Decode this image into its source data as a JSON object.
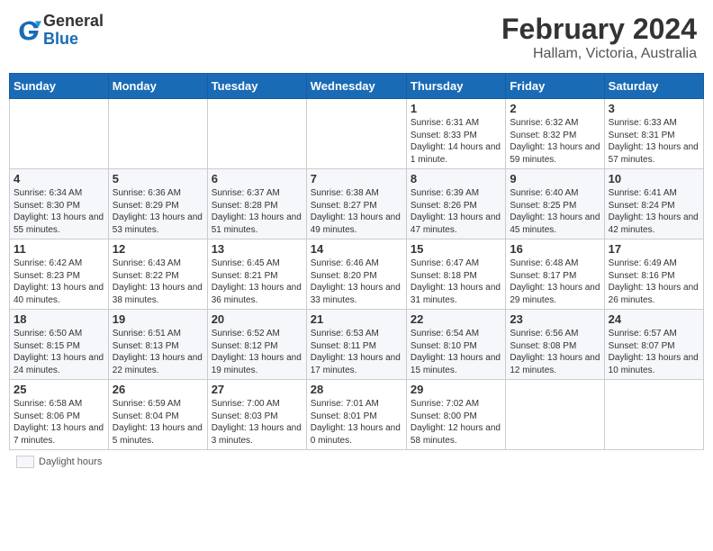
{
  "header": {
    "logo_general": "General",
    "logo_blue": "Blue",
    "month": "February 2024",
    "location": "Hallam, Victoria, Australia"
  },
  "legend": {
    "label": "Daylight hours"
  },
  "days_of_week": [
    "Sunday",
    "Monday",
    "Tuesday",
    "Wednesday",
    "Thursday",
    "Friday",
    "Saturday"
  ],
  "weeks": [
    [
      {
        "day": "",
        "info": ""
      },
      {
        "day": "",
        "info": ""
      },
      {
        "day": "",
        "info": ""
      },
      {
        "day": "",
        "info": ""
      },
      {
        "day": "1",
        "info": "Sunrise: 6:31 AM\nSunset: 8:33 PM\nDaylight: 14 hours and 1 minute."
      },
      {
        "day": "2",
        "info": "Sunrise: 6:32 AM\nSunset: 8:32 PM\nDaylight: 13 hours and 59 minutes."
      },
      {
        "day": "3",
        "info": "Sunrise: 6:33 AM\nSunset: 8:31 PM\nDaylight: 13 hours and 57 minutes."
      }
    ],
    [
      {
        "day": "4",
        "info": "Sunrise: 6:34 AM\nSunset: 8:30 PM\nDaylight: 13 hours and 55 minutes."
      },
      {
        "day": "5",
        "info": "Sunrise: 6:36 AM\nSunset: 8:29 PM\nDaylight: 13 hours and 53 minutes."
      },
      {
        "day": "6",
        "info": "Sunrise: 6:37 AM\nSunset: 8:28 PM\nDaylight: 13 hours and 51 minutes."
      },
      {
        "day": "7",
        "info": "Sunrise: 6:38 AM\nSunset: 8:27 PM\nDaylight: 13 hours and 49 minutes."
      },
      {
        "day": "8",
        "info": "Sunrise: 6:39 AM\nSunset: 8:26 PM\nDaylight: 13 hours and 47 minutes."
      },
      {
        "day": "9",
        "info": "Sunrise: 6:40 AM\nSunset: 8:25 PM\nDaylight: 13 hours and 45 minutes."
      },
      {
        "day": "10",
        "info": "Sunrise: 6:41 AM\nSunset: 8:24 PM\nDaylight: 13 hours and 42 minutes."
      }
    ],
    [
      {
        "day": "11",
        "info": "Sunrise: 6:42 AM\nSunset: 8:23 PM\nDaylight: 13 hours and 40 minutes."
      },
      {
        "day": "12",
        "info": "Sunrise: 6:43 AM\nSunset: 8:22 PM\nDaylight: 13 hours and 38 minutes."
      },
      {
        "day": "13",
        "info": "Sunrise: 6:45 AM\nSunset: 8:21 PM\nDaylight: 13 hours and 36 minutes."
      },
      {
        "day": "14",
        "info": "Sunrise: 6:46 AM\nSunset: 8:20 PM\nDaylight: 13 hours and 33 minutes."
      },
      {
        "day": "15",
        "info": "Sunrise: 6:47 AM\nSunset: 8:18 PM\nDaylight: 13 hours and 31 minutes."
      },
      {
        "day": "16",
        "info": "Sunrise: 6:48 AM\nSunset: 8:17 PM\nDaylight: 13 hours and 29 minutes."
      },
      {
        "day": "17",
        "info": "Sunrise: 6:49 AM\nSunset: 8:16 PM\nDaylight: 13 hours and 26 minutes."
      }
    ],
    [
      {
        "day": "18",
        "info": "Sunrise: 6:50 AM\nSunset: 8:15 PM\nDaylight: 13 hours and 24 minutes."
      },
      {
        "day": "19",
        "info": "Sunrise: 6:51 AM\nSunset: 8:13 PM\nDaylight: 13 hours and 22 minutes."
      },
      {
        "day": "20",
        "info": "Sunrise: 6:52 AM\nSunset: 8:12 PM\nDaylight: 13 hours and 19 minutes."
      },
      {
        "day": "21",
        "info": "Sunrise: 6:53 AM\nSunset: 8:11 PM\nDaylight: 13 hours and 17 minutes."
      },
      {
        "day": "22",
        "info": "Sunrise: 6:54 AM\nSunset: 8:10 PM\nDaylight: 13 hours and 15 minutes."
      },
      {
        "day": "23",
        "info": "Sunrise: 6:56 AM\nSunset: 8:08 PM\nDaylight: 13 hours and 12 minutes."
      },
      {
        "day": "24",
        "info": "Sunrise: 6:57 AM\nSunset: 8:07 PM\nDaylight: 13 hours and 10 minutes."
      }
    ],
    [
      {
        "day": "25",
        "info": "Sunrise: 6:58 AM\nSunset: 8:06 PM\nDaylight: 13 hours and 7 minutes."
      },
      {
        "day": "26",
        "info": "Sunrise: 6:59 AM\nSunset: 8:04 PM\nDaylight: 13 hours and 5 minutes."
      },
      {
        "day": "27",
        "info": "Sunrise: 7:00 AM\nSunset: 8:03 PM\nDaylight: 13 hours and 3 minutes."
      },
      {
        "day": "28",
        "info": "Sunrise: 7:01 AM\nSunset: 8:01 PM\nDaylight: 13 hours and 0 minutes."
      },
      {
        "day": "29",
        "info": "Sunrise: 7:02 AM\nSunset: 8:00 PM\nDaylight: 12 hours and 58 minutes."
      },
      {
        "day": "",
        "info": ""
      },
      {
        "day": "",
        "info": ""
      }
    ]
  ]
}
